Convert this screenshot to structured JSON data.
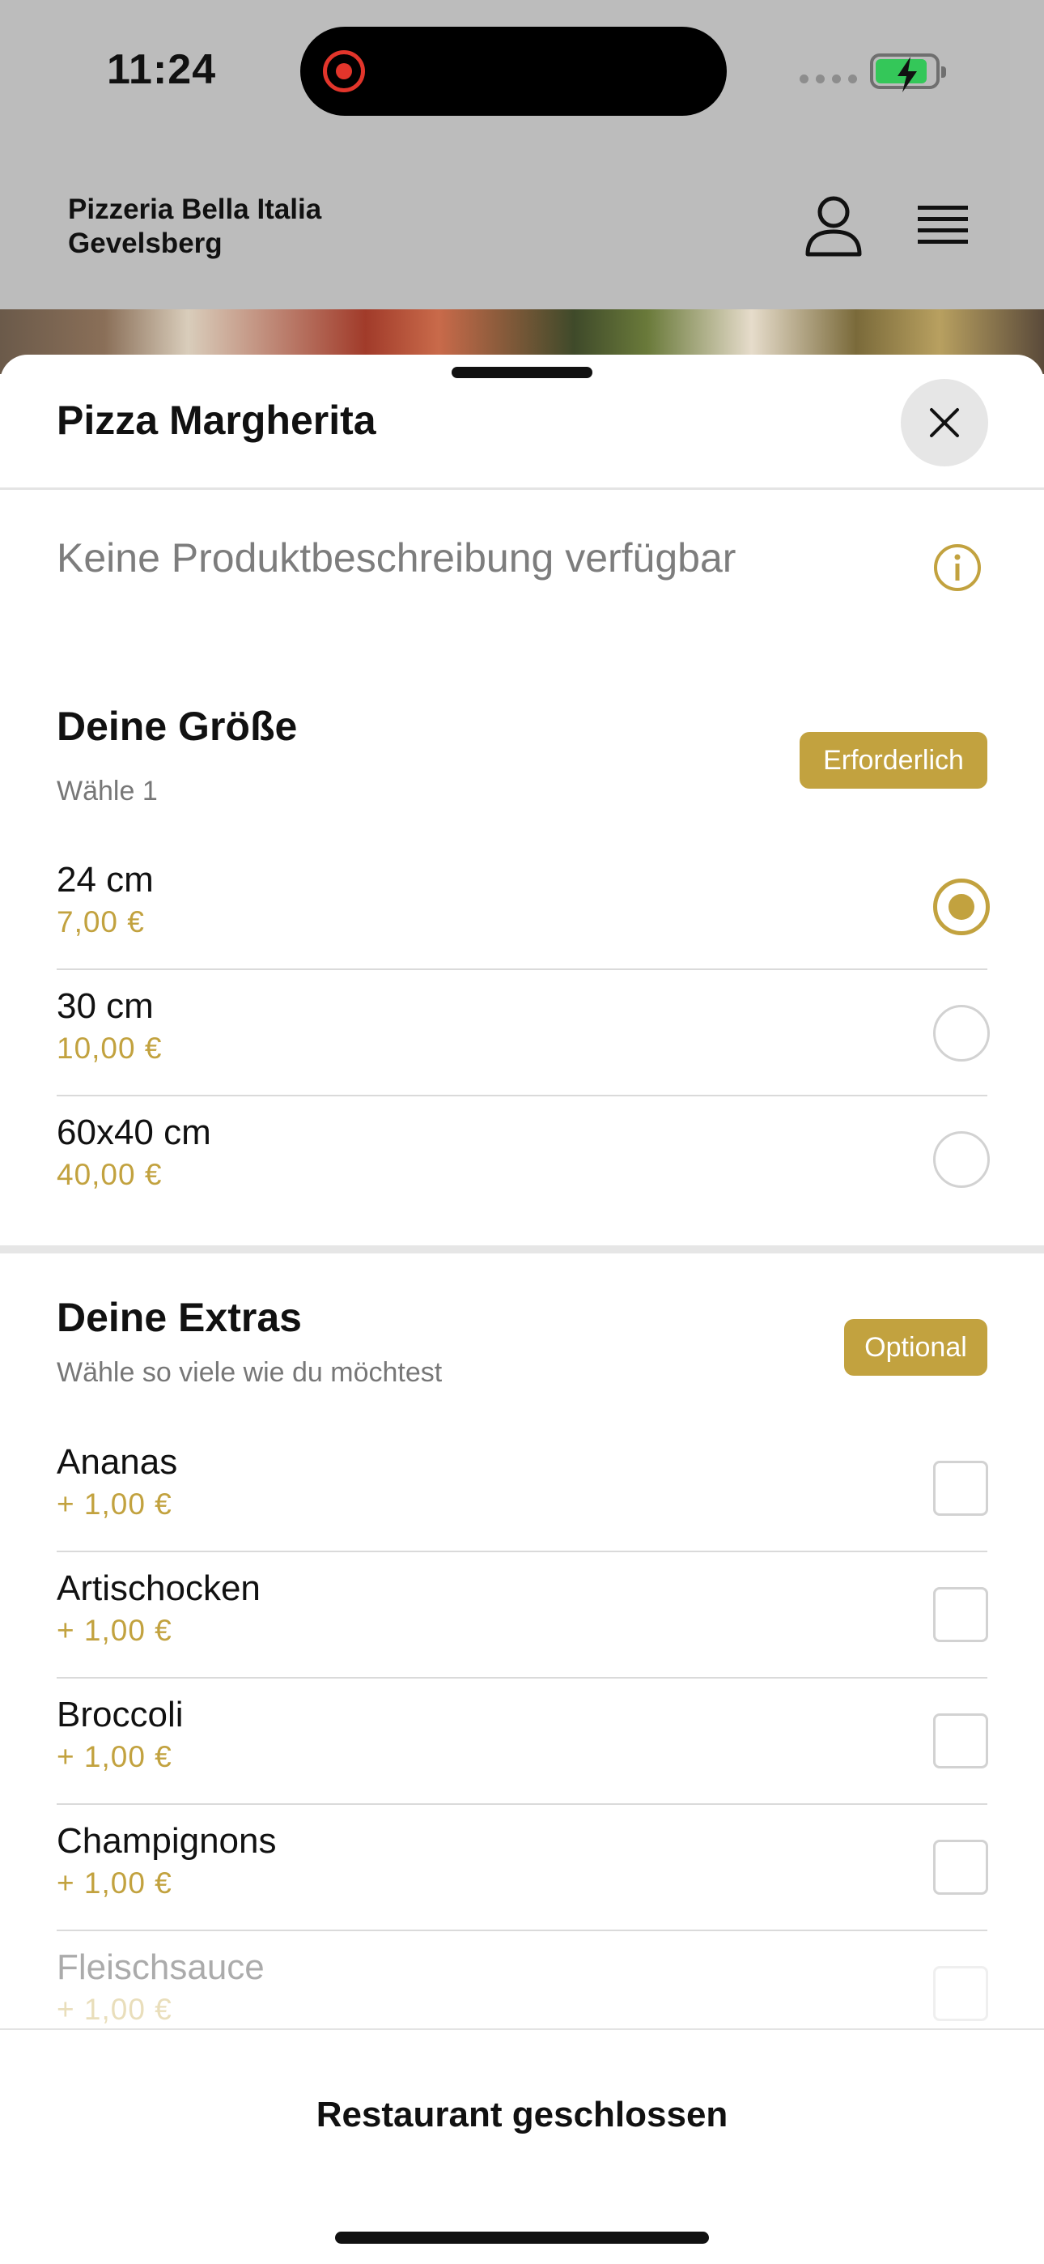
{
  "status_bar": {
    "time": "11:24",
    "battery_color": "#34c759",
    "recording_color": "#e2352b"
  },
  "header": {
    "restaurant_line1": "Pizzeria Bella Italia",
    "restaurant_line2": "Gevelsberg",
    "icons": [
      "user-icon",
      "hamburger-menu-icon"
    ]
  },
  "sheet": {
    "title": "Pizza Margherita",
    "description": "Keine Produktbeschreibung verfügbar",
    "accent_color": "#c2a23f"
  },
  "size_section": {
    "title": "Deine Größe",
    "subtitle": "Wähle 1",
    "badge": "Erforderlich",
    "options": [
      {
        "name": "24 cm",
        "price": "7,00 €",
        "selected": true
      },
      {
        "name": "30 cm",
        "price": "10,00 €",
        "selected": false
      },
      {
        "name": "60x40 cm",
        "price": "40,00 €",
        "selected": false
      }
    ]
  },
  "extras_section": {
    "title": "Deine Extras",
    "subtitle": "Wähle so viele wie du möchtest",
    "badge": "Optional",
    "options": [
      {
        "name": "Ananas",
        "price": "+ 1,00 €",
        "checked": false
      },
      {
        "name": "Artischocken",
        "price": "+ 1,00 €",
        "checked": false
      },
      {
        "name": "Broccoli",
        "price": "+ 1,00 €",
        "checked": false
      },
      {
        "name": "Champignons",
        "price": "+ 1,00 €",
        "checked": false
      },
      {
        "name": "Fleischsauce",
        "price": "+ 1,00 €",
        "checked": false
      }
    ]
  },
  "footer": {
    "button_label": "Restaurant geschlossen"
  }
}
